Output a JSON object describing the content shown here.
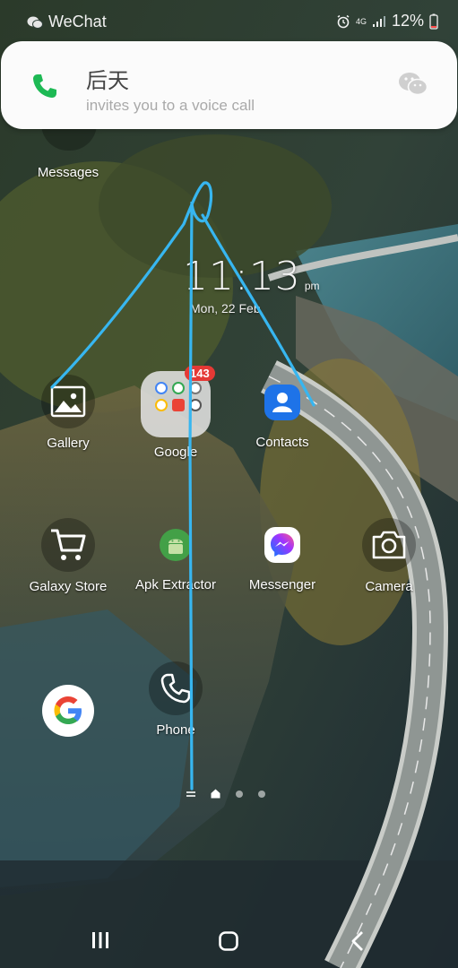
{
  "status_bar": {
    "app_name": "WeChat",
    "network": "4G",
    "battery": "12%"
  },
  "call_notification": {
    "caller": "后天",
    "message": "invites you to a voice call"
  },
  "home": {
    "top_app_label": "Messages",
    "clock": {
      "time": "11:13",
      "ampm": "pm",
      "date": "Mon, 22 Feb"
    },
    "apps": [
      {
        "label": "Gallery",
        "icon": "gallery-icon"
      },
      {
        "label": "Google",
        "icon": "google-folder-icon",
        "badge": "143"
      },
      {
        "label": "Contacts",
        "icon": "contacts-icon"
      },
      {
        "label": "Galaxy Store",
        "icon": "shopping-cart-icon"
      },
      {
        "label": "Apk Extractor",
        "icon": "android-icon"
      },
      {
        "label": "Messenger",
        "icon": "messenger-icon"
      },
      {
        "label": "Camera",
        "icon": "camera-icon"
      },
      {
        "label": "",
        "icon": "google-g-icon"
      },
      {
        "label": "Phone",
        "icon": "phone-icon"
      }
    ]
  },
  "colors": {
    "call_green": "#1db954",
    "badge_red": "#e53935",
    "scribble_blue": "#37b6f0",
    "contacts_blue": "#1e73e8"
  },
  "navigation": {
    "buttons": [
      "recents-icon",
      "home-icon",
      "back-icon"
    ]
  }
}
